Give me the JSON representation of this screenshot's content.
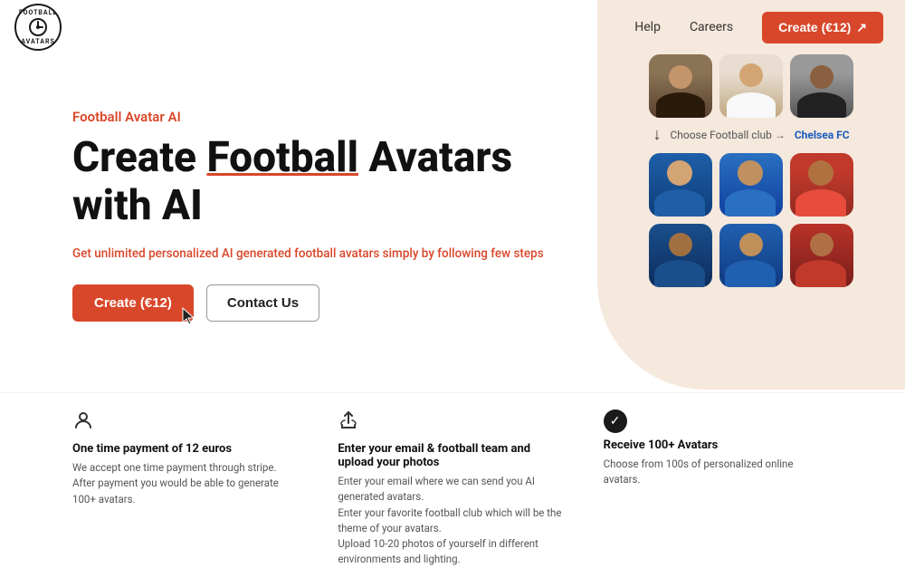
{
  "brand": {
    "name_top": "FOOTBALL",
    "name_bottom": "AVATARS"
  },
  "nav": {
    "help_label": "Help",
    "careers_label": "Careers",
    "create_btn_label": "Create (€12)"
  },
  "hero": {
    "subtitle": "Football Avatar AI",
    "title_part1": "Create ",
    "title_football": "Football",
    "title_part2": " Avatars with AI",
    "description": "Get unlimited personalized AI generated football avatars simply by following few steps",
    "create_btn_label": "Create (€12)",
    "contact_btn_label": "Contact Us"
  },
  "club_row": {
    "label": "Choose Football club →",
    "club_name": "Chelsea FC"
  },
  "features": [
    {
      "icon": "user-icon",
      "title": "One time payment of 12 euros",
      "desc_line1": "We accept one time payment through stripe.",
      "desc_line2": "After payment you would be able to generate 100+ avatars."
    },
    {
      "icon": "upload-icon",
      "title": "Enter your email & football team and upload your photos",
      "desc_line1": "Enter your email where we can send you AI generated avatars.",
      "desc_line2": "Enter your favorite football club which will be the theme of your avatars.",
      "desc_line3": "Upload 10-20 photos of yourself in different environments and lighting."
    },
    {
      "icon": "check-icon",
      "title": "Receive 100+ Avatars",
      "desc_line1": "Choose from 100s of personalized online avatars."
    }
  ]
}
